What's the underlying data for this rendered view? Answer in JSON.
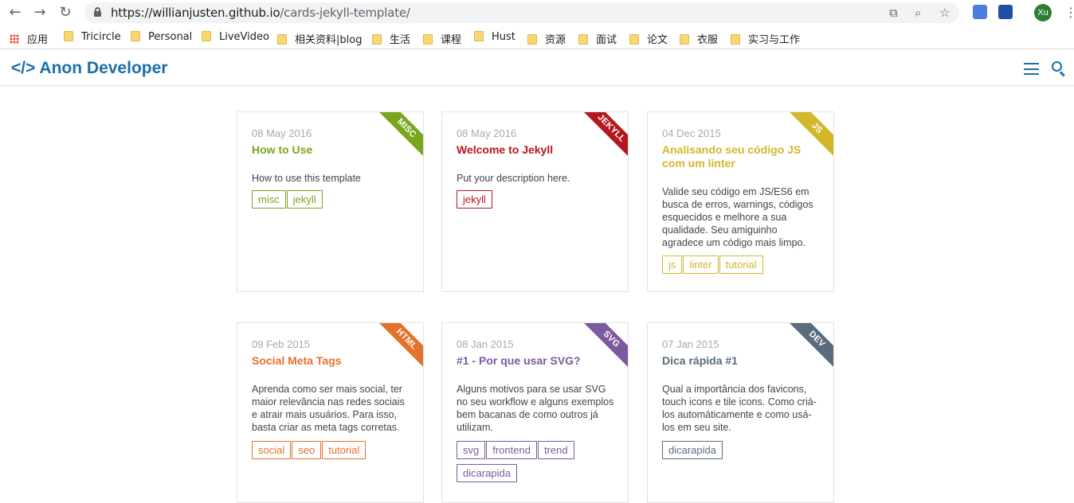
{
  "browser": {
    "url_host": "https://willianjusten.github.io",
    "url_path": "/cards-jekyll-template/",
    "avatar_text": "Xu",
    "icons": [
      "back-icon",
      "forward-icon",
      "reload-icon",
      "lock-icon",
      "translate-icon",
      "zoom-icon",
      "star-icon",
      "kebab-menu-icon"
    ]
  },
  "bookmarks": [
    {
      "label": "应用",
      "icon": "apps-grid-icon"
    },
    {
      "label": "Tricircle",
      "icon": "folder-icon"
    },
    {
      "label": "Personal",
      "icon": "folder-icon"
    },
    {
      "label": "LiveVideo",
      "icon": "folder-icon"
    },
    {
      "label": "相关资料|blog",
      "icon": "folder-icon"
    },
    {
      "label": "生活",
      "icon": "folder-icon"
    },
    {
      "label": "课程",
      "icon": "folder-icon"
    },
    {
      "label": "Hust",
      "icon": "folder-icon"
    },
    {
      "label": "资源",
      "icon": "folder-icon"
    },
    {
      "label": "面试",
      "icon": "folder-icon"
    },
    {
      "label": "论文",
      "icon": "folder-icon"
    },
    {
      "label": "衣服",
      "icon": "folder-icon"
    },
    {
      "label": "实习与工作",
      "icon": "folder-icon"
    }
  ],
  "site": {
    "logo": "</> Anon Developer",
    "brand_color": "#1b6fa8"
  },
  "cards": [
    {
      "ribbon": "MISC",
      "color": "#7aa61e",
      "date": "08 May 2016",
      "title": "How to Use",
      "description": "How to use this template",
      "tags": [
        "misc",
        "jekyll"
      ]
    },
    {
      "ribbon": "JEKYLL",
      "color": "#b5171d",
      "date": "08 May 2016",
      "title": "Welcome to Jekyll",
      "description": "Put your description here.",
      "tags": [
        "jekyll"
      ]
    },
    {
      "ribbon": "JS",
      "color": "#d2b72b",
      "date": "04 Dec 2015",
      "title": "Analisando seu código JS com um linter",
      "description": "Valide seu código em JS/ES6 em busca de erros, warnings, códigos esquecidos e melhore a sua qualidade. Seu amiguinho agradece um código mais limpo.",
      "tags": [
        "js",
        "linter",
        "tutorial"
      ]
    },
    {
      "ribbon": "HTML",
      "color": "#e5722c",
      "date": "09 Feb 2015",
      "title": "Social Meta Tags",
      "description": "Aprenda como ser mais social, ter maior relevância nas redes sociais e atrair mais usuários. Para isso, basta criar as meta tags corretas.",
      "tags": [
        "social",
        "seo",
        "tutorial"
      ]
    },
    {
      "ribbon": "SVG",
      "color": "#7b5aa0",
      "date": "08 Jan 2015",
      "title": "#1 - Por que usar SVG?",
      "description": "Alguns motivos para se usar SVG no seu workflow e alguns exemplos bem bacanas de como outros já utilizam.",
      "tags": [
        "svg",
        "frontend",
        "trend",
        "dicarapida"
      ]
    },
    {
      "ribbon": "DEV",
      "color": "#5a6b7e",
      "date": "07 Jan 2015",
      "title": "Dica rápida #1",
      "description": "Qual a importância dos favicons, touch icons e tile icons. Como criá-los automáticamente e como usá-los em seu site.",
      "tags": [
        "dicarapida"
      ]
    }
  ]
}
